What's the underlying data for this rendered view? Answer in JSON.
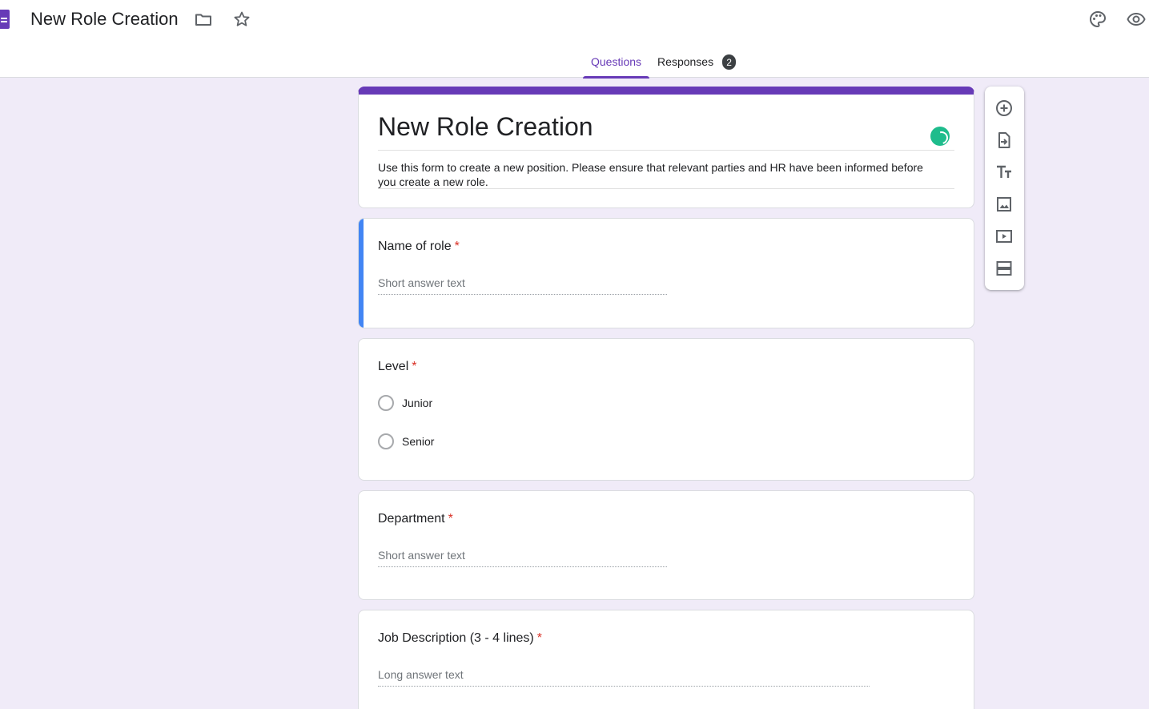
{
  "header": {
    "doc_title": "New Role Creation",
    "icons": [
      "forms-logo",
      "folder-icon",
      "star-icon",
      "palette-icon",
      "eye-icon"
    ]
  },
  "tabs": [
    {
      "label": "Questions",
      "active": true
    },
    {
      "label": "Responses",
      "badge": "2",
      "active": false
    }
  ],
  "form": {
    "title": "New Role Creation",
    "description": "Use this form to create a new position. Please ensure that relevant parties and HR have been informed before you create a new role."
  },
  "questions": [
    {
      "title": "Name of role",
      "required_mark": "*",
      "placeholder": "Short answer text"
    },
    {
      "title": "Level",
      "required_mark": "*",
      "options": [
        "Junior",
        "Senior"
      ]
    },
    {
      "title": "Department",
      "required_mark": "*",
      "placeholder": "Short answer text"
    },
    {
      "title": "Job Description (3 - 4 lines)",
      "required_mark": "*",
      "placeholder": "Long answer text"
    }
  ],
  "toolbar": {
    "icons": [
      "add-question-icon",
      "import-questions-icon",
      "add-title-icon",
      "add-image-icon",
      "add-video-icon",
      "add-section-icon"
    ]
  },
  "colors": {
    "accent": "#673ab7",
    "background": "#f0ebf8",
    "selected_bar": "#4285f4",
    "required": "#d93025"
  }
}
